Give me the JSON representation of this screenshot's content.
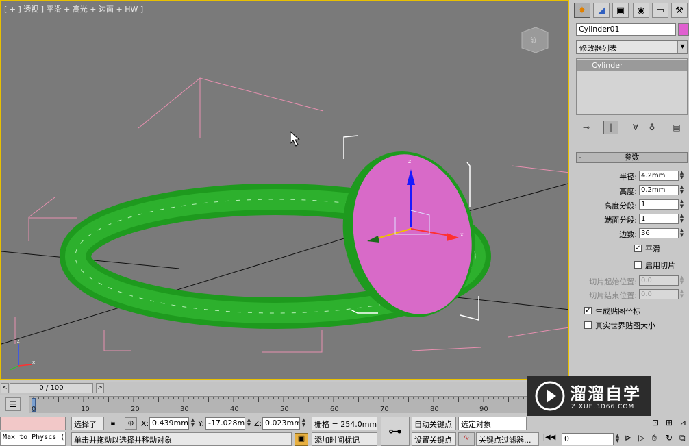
{
  "viewport": {
    "label": "[ + ] 透视 ] 平滑 + 高光 + 边面 + HW ]",
    "view_cube_label": "前",
    "colors": {
      "background": "#7a7a7a",
      "border": "#e8c000",
      "ring": "#1e9a1e",
      "cylinder": "#d86ac8"
    }
  },
  "command_panel": {
    "tabs": [
      "create-icon",
      "modify-icon",
      "hierarchy-icon",
      "motion-icon",
      "display-icon",
      "utilities-icon"
    ],
    "object_name": "Cylinder01",
    "object_color": "#e060d0",
    "modifier_list": "修改器列表",
    "stack_item": "Cylinder",
    "parameters": {
      "title": "参数",
      "radius_label": "半径:",
      "radius_value": "4.2mm",
      "height_label": "高度:",
      "height_value": "0.2mm",
      "height_segments_label": "高度分段:",
      "height_segments_value": "1",
      "cap_segments_label": "端面分段:",
      "cap_segments_value": "1",
      "sides_label": "边数:",
      "sides_value": "36",
      "smooth_label": "平滑",
      "slice_on_label": "启用切片",
      "slice_from_label": "切片起始位置:",
      "slice_from_value": "0.0",
      "slice_to_label": "切片结束位置:",
      "slice_to_value": "0.0",
      "gen_mapping_label": "生成贴图坐标",
      "real_world_label": "真实世界贴图大小"
    }
  },
  "timeline": {
    "frame": "0 / 100",
    "ticks": [
      "0",
      "10",
      "20",
      "30",
      "40",
      "50",
      "60",
      "70",
      "80",
      "90"
    ]
  },
  "status": {
    "script": "Max to Physcs (",
    "selected": "选择了",
    "x_label": "X:",
    "x_value": "0.439mm",
    "y_label": "Y:",
    "y_value": "-17.028mm",
    "z_label": "Z:",
    "z_value": "0.023mm",
    "grid": "栅格 = 254.0mm",
    "auto_key": "自动关键点",
    "selected_object": "选定对象",
    "prompt": "单击并拖动以选择并移动对象",
    "add_time_tag": "添加时间标记",
    "set_key": "设置关键点",
    "key_filters": "关键点过滤器...",
    "frame_value": "0"
  },
  "watermark": {
    "title": "溜溜自学",
    "url": "ZIXUE.3D66.COM"
  }
}
